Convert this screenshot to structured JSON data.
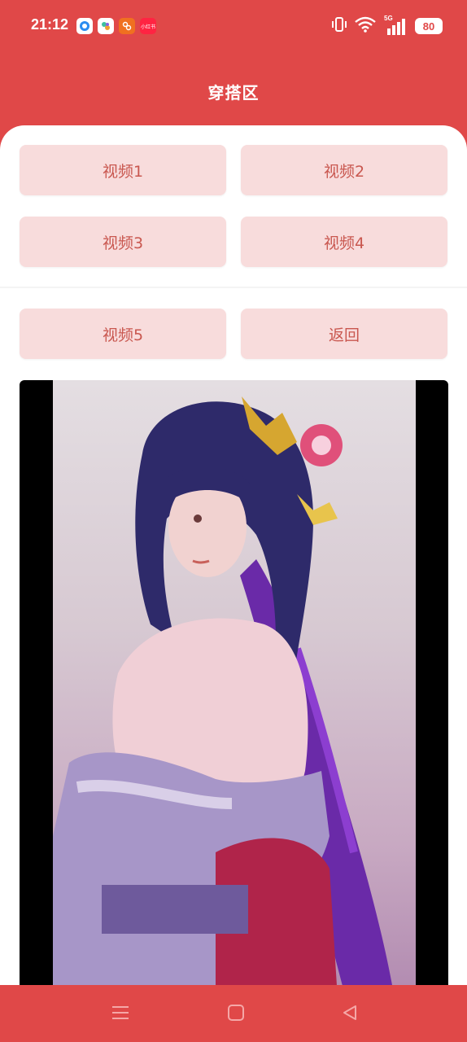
{
  "status_bar": {
    "time": "21:12",
    "battery": "80",
    "network": "5G",
    "app_icons": [
      "browser-app-icon",
      "gallery-app-icon",
      "shopping-app-icon",
      "xiaohongshu-app-icon"
    ],
    "xhs_label": "小红书"
  },
  "page": {
    "title": "穿搭区"
  },
  "buttons": {
    "video1": "视频1",
    "video2": "视频2",
    "video3": "视频3",
    "video4": "视频4",
    "video5": "视频5",
    "back": "返回"
  },
  "colors": {
    "accent": "#e04848",
    "button_bg": "#f8dcdc",
    "button_text": "#c9574f"
  },
  "nav_icons": [
    "menu-icon",
    "home-icon",
    "back-triangle-icon"
  ]
}
